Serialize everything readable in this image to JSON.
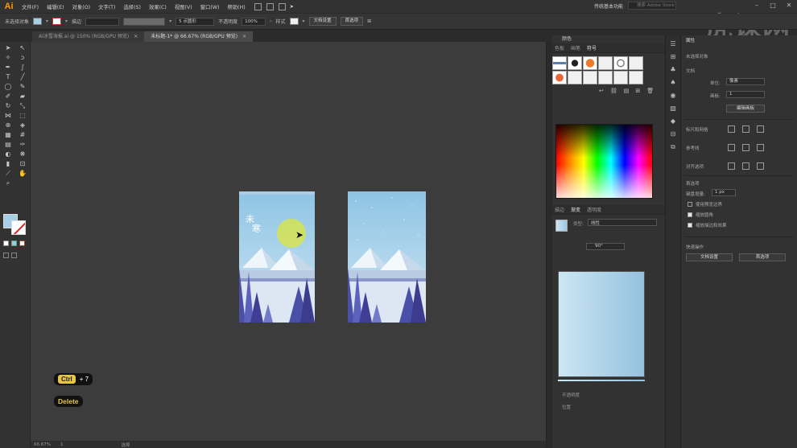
{
  "app": {
    "logo": "Ai"
  },
  "menubar": {
    "items": [
      "文件(F)",
      "编辑(E)",
      "对象(O)",
      "文字(T)",
      "选择(S)",
      "效果(C)",
      "视图(V)",
      "窗口(W)",
      "帮助(H)"
    ],
    "workspace": "传统基本功能",
    "search_placeholder": "搜索 Adobe Stock"
  },
  "watermark": "虎课网",
  "options_bar": {
    "selection_label": "未选择对象",
    "stroke_label": "描边",
    "stroke_value": "",
    "brush_label": "5 点圆形",
    "opacity_label": "不透明度",
    "opacity_value": "100%",
    "style_label": "样式",
    "doc_setup": "文档设置",
    "prefs": "首选项"
  },
  "tabs": [
    {
      "label": "AI冰雪海报.ai @ 150% (RGB/GPU 预览)",
      "active": false
    },
    {
      "label": "未标题-1* @ 66.67% (RGB/GPU 预览)",
      "active": true
    }
  ],
  "shortcuts": {
    "ctrl": "Ctrl",
    "plus": "+ 7",
    "delete": "Delete"
  },
  "statusbar": {
    "zoom": "66.67%",
    "page": "1",
    "mode": "选择"
  },
  "color_panel": {
    "title": "颜色"
  },
  "brush_tabs": [
    "色板",
    "画笔",
    "符号"
  ],
  "gradient_tabs": [
    "描边",
    "渐变",
    "透明度"
  ],
  "gradient": {
    "type_label": "类型:",
    "type_value": "线性",
    "angle_value": "90°",
    "opacity_label": "不透明度",
    "position_label": "位置"
  },
  "props_panel": {
    "title": "属性",
    "no_selection": "未选择对象",
    "document": "文档",
    "units_label": "单位:",
    "units_value": "像素",
    "artboard_label": "画板:",
    "artboard_value": "1",
    "edit_artboard": "编辑画板",
    "rulers_grids": "标尺和网格",
    "guides": "参考线",
    "snap": "对齐选项",
    "preferences": "首选项",
    "keyboard_inc_label": "键盘增量:",
    "keyboard_inc_value": "1 px",
    "preview_bounds": "使用预览边界",
    "scale_corners": "缩放圆角",
    "scale_strokes": "缩放描边和效果",
    "quick_actions": "快速操作",
    "doc_setup": "文档设置",
    "prefs": "首选项"
  },
  "colors": {
    "fill": "#a4cfe6",
    "accent": "#e9c44a"
  }
}
